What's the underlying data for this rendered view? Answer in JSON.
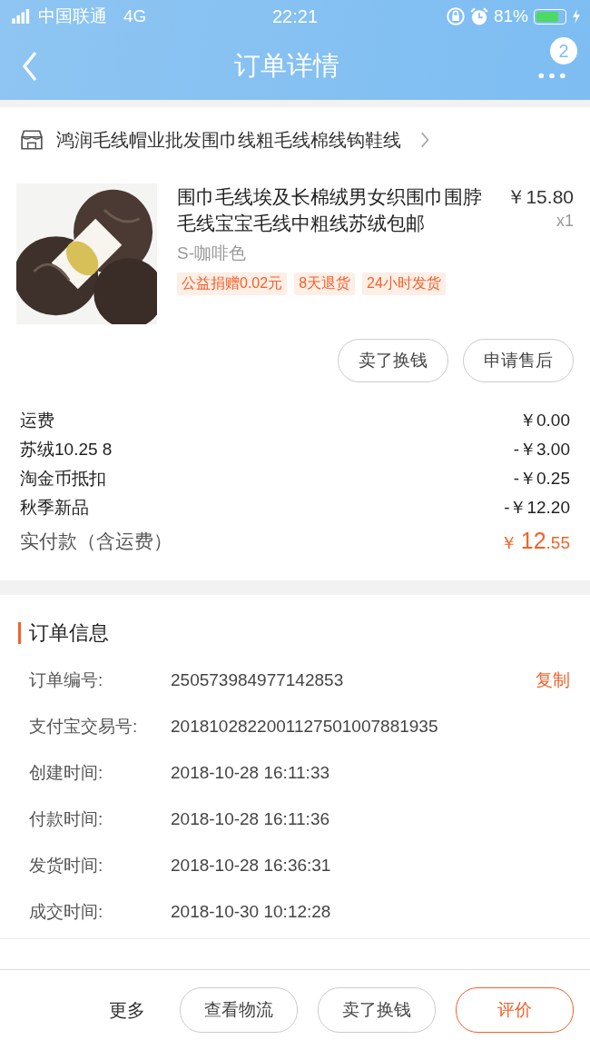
{
  "status_bar": {
    "carrier": "中国联通",
    "network": "4G",
    "time": "22:21",
    "battery_text": "81%"
  },
  "nav": {
    "title": "订单详情",
    "badge": "2"
  },
  "shop": {
    "name": "鸿润毛线帽业批发围巾线粗毛线棉线钩鞋线"
  },
  "product": {
    "image": {
      "kind": "picture"
    },
    "title": "围巾毛线埃及长棉绒男女织围巾围脖毛线宝宝毛线中粗线苏绒包邮",
    "price": "￥15.80",
    "quantity": "x1",
    "sku": "S-咖啡色",
    "tags": [
      "公益捐赠0.02元",
      "8天退货",
      "24小时发货"
    ],
    "actions": [
      "卖了换钱",
      "申请售后"
    ]
  },
  "fees": [
    {
      "label": "运费",
      "value": "￥0.00"
    },
    {
      "label": "苏绒10.25  8",
      "value": "-￥3.00"
    },
    {
      "label": "淘金币抵扣",
      "value": "-￥0.25"
    },
    {
      "label": "秋季新品",
      "value": "-￥12.20"
    }
  ],
  "total": {
    "label": "实付款（含运费）",
    "currency": "￥",
    "integer": "12",
    "decimal": ".55"
  },
  "order_info": {
    "title": "订单信息",
    "rows": [
      {
        "label": "订单编号:",
        "value": "250573984977142853",
        "action": "复制"
      },
      {
        "label": "支付宝交易号:",
        "value": "2018102822001127501007881935"
      },
      {
        "label": "创建时间:",
        "value": "2018-10-28 16:11:33"
      },
      {
        "label": "付款时间:",
        "value": "2018-10-28 16:11:36"
      },
      {
        "label": "发货时间:",
        "value": "2018-10-28 16:36:31"
      },
      {
        "label": "成交时间:",
        "value": "2018-10-30 10:12:28"
      }
    ]
  },
  "bottom_bar": {
    "more": "更多",
    "buttons": [
      {
        "label": "查看物流",
        "primary": false
      },
      {
        "label": "卖了换钱",
        "primary": false
      },
      {
        "label": "评价",
        "primary": true
      }
    ]
  }
}
